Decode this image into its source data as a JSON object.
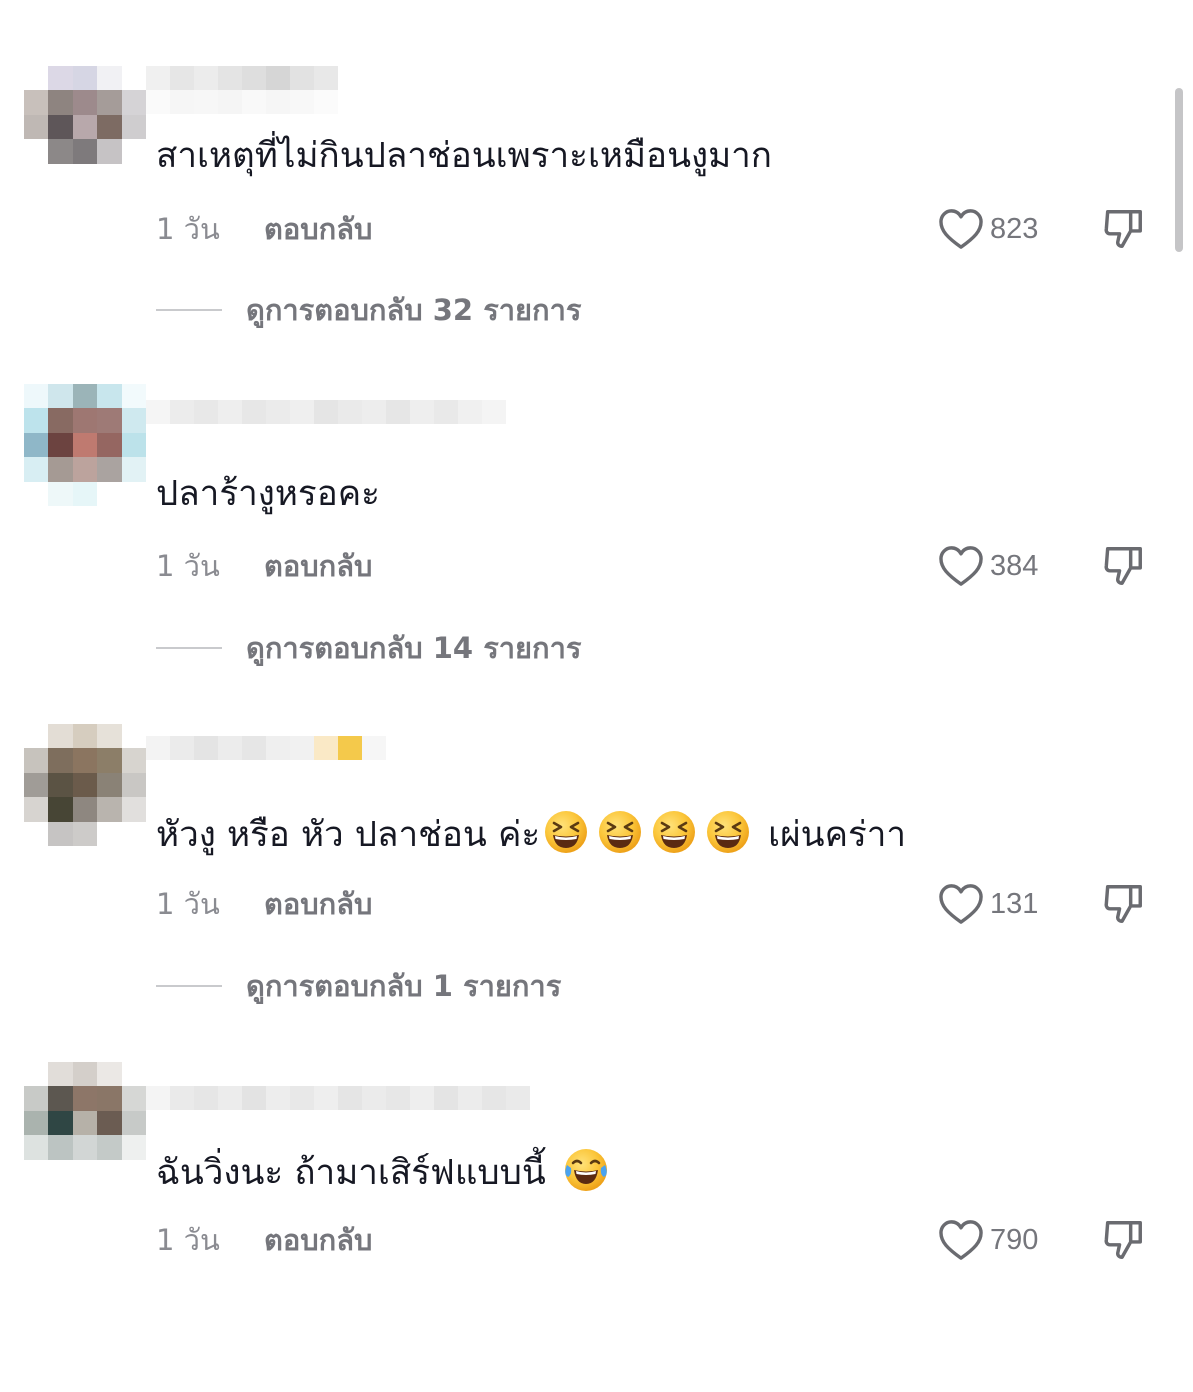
{
  "comments": [
    {
      "text": "สาเหตุที่ไม่กินปลาช่อนเพราะเหมือนงูมาก",
      "time": "1 วัน",
      "reply_label": "ตอบกลับ",
      "likes": "823",
      "view_replies": "ดูการตอบกลับ 32 รายการ"
    },
    {
      "text": "ปลาร้างูหรอคะ",
      "time": "1 วัน",
      "reply_label": "ตอบกลับ",
      "likes": "384",
      "view_replies": "ดูการตอบกลับ 14 รายการ"
    },
    {
      "text_before": "หัวงู หรือ หัว ปลาช่อน ค่ะ",
      "text_after": "เผ่นคร่าา",
      "emoji": "grinning-squinting-face",
      "emoji_count": 4,
      "time": "1 วัน",
      "reply_label": "ตอบกลับ",
      "likes": "131",
      "view_replies": "ดูการตอบกลับ 1 รายการ"
    },
    {
      "text": "ฉันวิ่งนะ ถ้ามาเสิร์ฟแบบนี้",
      "emoji": "face-with-tears-of-joy",
      "time": "1 วัน",
      "reply_label": "ตอบกลับ",
      "likes": "790"
    }
  ],
  "icons": {
    "like": "heart-outline-icon",
    "dislike": "thumbs-down-outline-icon"
  },
  "colors": {
    "text_primary": "#161823",
    "text_secondary": "#75767c",
    "emoji_yellow": "#fbc63a"
  }
}
